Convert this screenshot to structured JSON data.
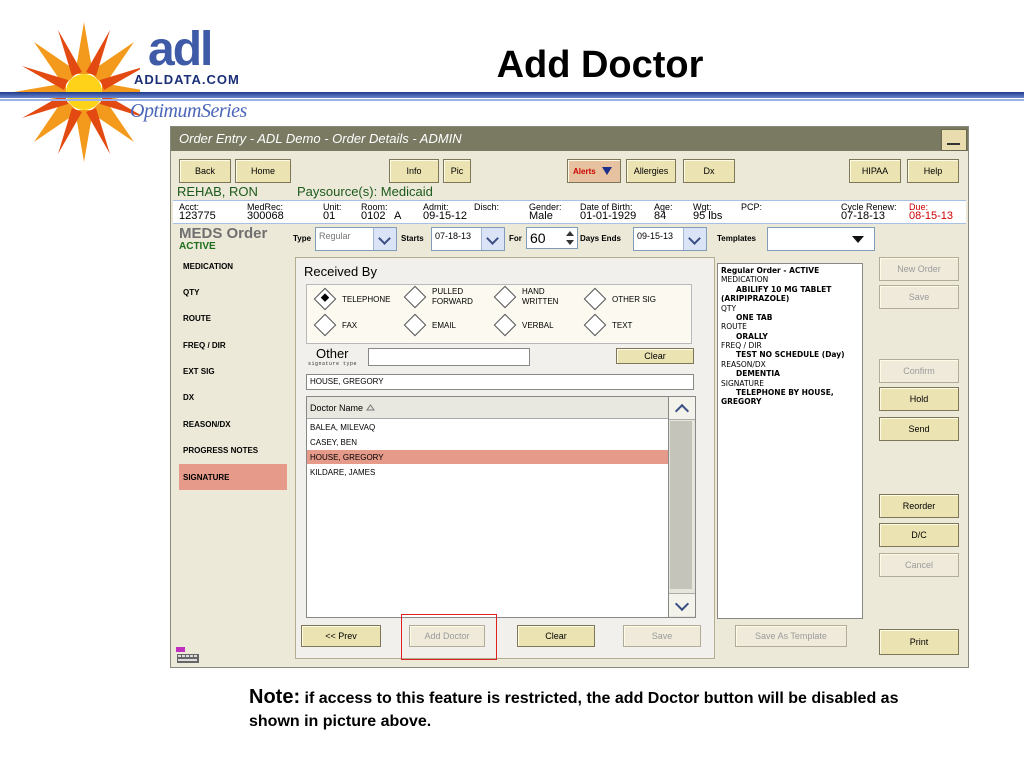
{
  "slide": {
    "title": "Add Doctor",
    "brand_adl": "adl",
    "brand_domain": "ADLDATA.COM",
    "brand_series": "OptimumSeries",
    "note_label": "Note:",
    "note_text": " if access to this feature is restricted, the add Doctor button will be disabled as shown in picture above."
  },
  "window": {
    "title": "Order Entry - ADL  Demo - Order Details - ADMIN"
  },
  "toolbar": {
    "back": "Back",
    "home": "Home",
    "info": "Info",
    "pic": "Pic",
    "alerts": "Alerts",
    "allergies": "Allergies",
    "dx": "Dx",
    "hipaa": "HIPAA",
    "help": "Help"
  },
  "patient": {
    "name": "REHAB, RON",
    "paysource": "Paysource(s): Medicaid",
    "fields": [
      {
        "label": "Acct:",
        "value": "123775"
      },
      {
        "label": "MedRec:",
        "value": "300068"
      },
      {
        "label": "Unit:",
        "value": "01"
      },
      {
        "label": "Room:",
        "value": "0102   A"
      },
      {
        "label": "Admit:",
        "value": "09-15-12"
      },
      {
        "label": "Disch:",
        "value": ""
      },
      {
        "label": "Gender:",
        "value": "Male"
      },
      {
        "label": "Date of Birth:",
        "value": "01-01-1929"
      },
      {
        "label": "Age:",
        "value": "84"
      },
      {
        "label": "Wgt:",
        "value": "95 lbs"
      },
      {
        "label": "PCP:",
        "value": ""
      },
      {
        "label": "Cycle Renew:",
        "value": "07-18-13"
      },
      {
        "label": "Due:",
        "value": "08-15-13"
      }
    ]
  },
  "order": {
    "title": "MEDS Order",
    "status": "ACTIVE",
    "type_label": "Type",
    "type_value": "Regular",
    "starts_label": "Starts",
    "starts_value": "07-18-13",
    "for_label": "For",
    "for_value": "60",
    "days_ends_label": "Days  Ends",
    "ends_value": "09-15-13",
    "templates_label": "Templates"
  },
  "sidebar": {
    "items": [
      "MEDICATION",
      "QTY",
      "ROUTE",
      "FREQ / DIR",
      "EXT SIG",
      "DX",
      "REASON/DX",
      "PROGRESS NOTES",
      "SIGNATURE"
    ],
    "active": "SIGNATURE"
  },
  "received": {
    "title": "Received By",
    "options": [
      "TELEPHONE",
      "PULLED FORWARD",
      "HAND WRITTEN",
      "OTHER SIG",
      "FAX",
      "EMAIL",
      "VERBAL",
      "TEXT"
    ],
    "selected": "TELEPHONE",
    "other_label": "Other",
    "signature_type_label": "signature type",
    "clear": "Clear",
    "signature_value": "HOUSE, GREGORY"
  },
  "doctors": {
    "header": "Doctor Name",
    "rows": [
      "BALEA, MILEVAQ",
      "CASEY, BEN",
      "HOUSE, GREGORY",
      "KILDARE, JAMES"
    ],
    "selected": "HOUSE, GREGORY"
  },
  "footer_buttons": {
    "prev": "<< Prev",
    "add_doctor": "Add Doctor",
    "clear": "Clear",
    "save": "Save",
    "save_template": "Save As Template",
    "print": "Print"
  },
  "preview": {
    "lines": [
      {
        "t": "Regular Order - ACTIVE",
        "s": "b"
      },
      {
        "t": "MEDICATION",
        "s": ""
      },
      {
        "t": "ABILIFY 10 MG TABLET",
        "s": "i"
      },
      {
        "t": "(ARIPIPRAZOLE)",
        "s": "b"
      },
      {
        "t": "QTY",
        "s": ""
      },
      {
        "t": "ONE TAB",
        "s": "i"
      },
      {
        "t": "ROUTE",
        "s": ""
      },
      {
        "t": "ORALLY",
        "s": "i"
      },
      {
        "t": "FREQ / DIR",
        "s": ""
      },
      {
        "t": "TEST NO SCHEDULE (Day)",
        "s": "i"
      },
      {
        "t": "REASON/DX",
        "s": ""
      },
      {
        "t": "DEMENTIA",
        "s": "i"
      },
      {
        "t": "SIGNATURE",
        "s": ""
      },
      {
        "t": "TELEPHONE BY HOUSE,",
        "s": "i"
      },
      {
        "t": "GREGORY",
        "s": "b"
      }
    ]
  },
  "right_buttons": {
    "new_order": "New Order",
    "save": "Save",
    "confirm": "Confirm",
    "hold": "Hold",
    "send": "Send",
    "reorder": "Reorder",
    "dc": "D/C",
    "cancel": "Cancel"
  },
  "colors": {
    "accent_highlight": "#e59a8a",
    "window_title": "#7a7a63",
    "alert_red": "#cc0000"
  }
}
